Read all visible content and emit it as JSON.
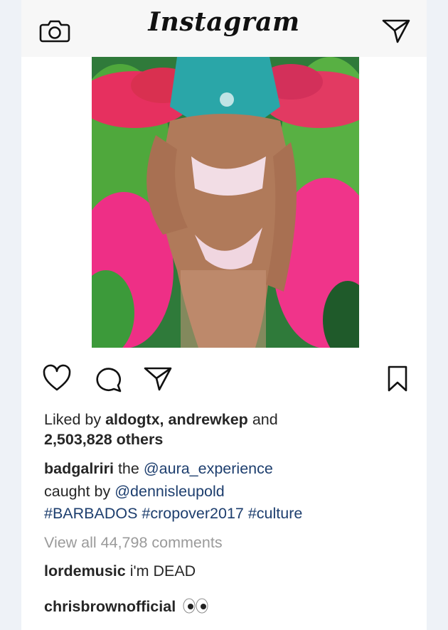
{
  "header": {
    "logo_text": "Instagram",
    "camera_icon": "camera-icon",
    "direct_icon": "paper-plane-icon"
  },
  "post": {
    "image_description_icon": "photo",
    "actions": {
      "like_icon": "heart-icon",
      "comment_icon": "comment-icon",
      "share_icon": "paper-plane-icon",
      "save_icon": "bookmark-icon"
    },
    "likes": {
      "prefix": "Liked by",
      "user1": "aldogtx",
      "sep": ",",
      "user2": "andrewkep",
      "and": "and",
      "count": "2,503,828 others"
    },
    "caption": {
      "username": "badgalriri",
      "word_the": "the",
      "mention1": "@aura_experience",
      "caught_by": "caught by",
      "mention2": "@dennisleupold",
      "hashtag1": "#BARBADOS",
      "hashtag2": "#cropover2017",
      "hashtag3": "#culture"
    },
    "view_comments": "View all 44,798 comments",
    "comments": [
      {
        "username": "lordemusic",
        "text": "i'm DEAD"
      },
      {
        "username": "chrisbrownofficial",
        "text": "",
        "emoji_icon": "eyes-emoji-icon"
      }
    ]
  },
  "colors": {
    "background": "#eef2f7",
    "header": "#f7f7f7",
    "link": "#1d3e6e",
    "muted": "#9a9a9a"
  }
}
